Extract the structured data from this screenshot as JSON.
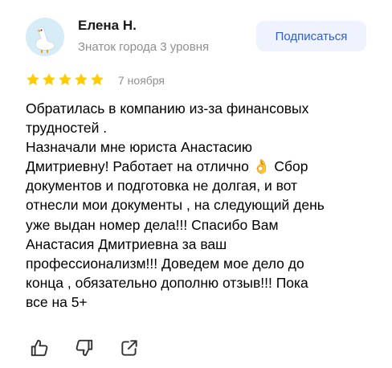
{
  "review": {
    "author": {
      "name": "Елена Н.",
      "level": "Знаток города 3 уровня",
      "avatar_icon": "goose-avatar-icon"
    },
    "subscribe_label": "Подписаться",
    "rating": {
      "value": 5,
      "max": 5,
      "color": "#fc0"
    },
    "date": "7 ноября",
    "text_lines": [
      "Обратилась в компанию из-за финансовых",
      "трудностей .",
      "Назначали мне юриста Анастасию",
      "Дмитриевну! Работает на отлично 👌 Сбор",
      "документов и подготовка не долгая, и вот",
      "отнесли мои документы , на следующий день",
      "уже выдан номер дела!!! Спасибо Вам",
      "Анастасия Дмитриевна за ваш",
      "профессионализм!!! Доведем мое дело до",
      "конца , обязательно дополню отзыв!!! Пока",
      "все на 5+"
    ],
    "actions": [
      "like-icon",
      "dislike-icon",
      "share-icon"
    ],
    "colors": {
      "accent": "#2e5fd8",
      "button_bg": "#eef3ff",
      "muted": "#8f8f8f"
    }
  }
}
